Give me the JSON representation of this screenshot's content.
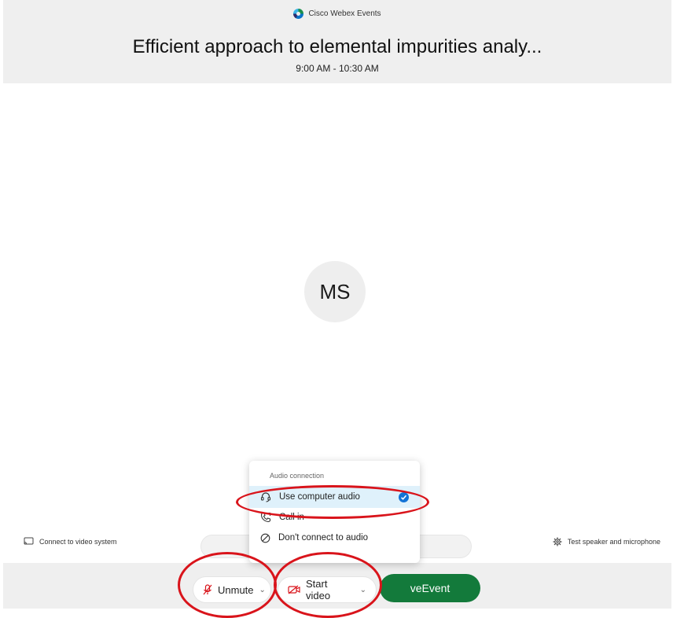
{
  "header": {
    "brand": "Cisco Webex Events",
    "title": "Efficient approach to elemental impurities analy...",
    "time": "9:00 AM - 10:30 AM"
  },
  "avatar": {
    "initials": "MS"
  },
  "audio_menu": {
    "header": "Audio connection",
    "items": [
      {
        "label": "Use computer audio",
        "icon": "headset-icon",
        "selected": true
      },
      {
        "label": "Call in",
        "icon": "phone-icon",
        "selected": false
      },
      {
        "label": "Don't connect to audio",
        "icon": "no-audio-icon",
        "selected": false
      }
    ]
  },
  "side": {
    "connect_video": "Connect to video system",
    "test_speaker": "Test speaker and microphone"
  },
  "toolbar": {
    "unmute_label": "Unmute",
    "video_label": "Start video",
    "event_label": "veEvent"
  },
  "colors": {
    "header_bg": "#efefef",
    "event_button": "#137a3b",
    "selected_item_bg": "#dff1fb",
    "check": "#1273d6",
    "annotation": "#d9141b",
    "mic_muted": "#d9141b"
  }
}
